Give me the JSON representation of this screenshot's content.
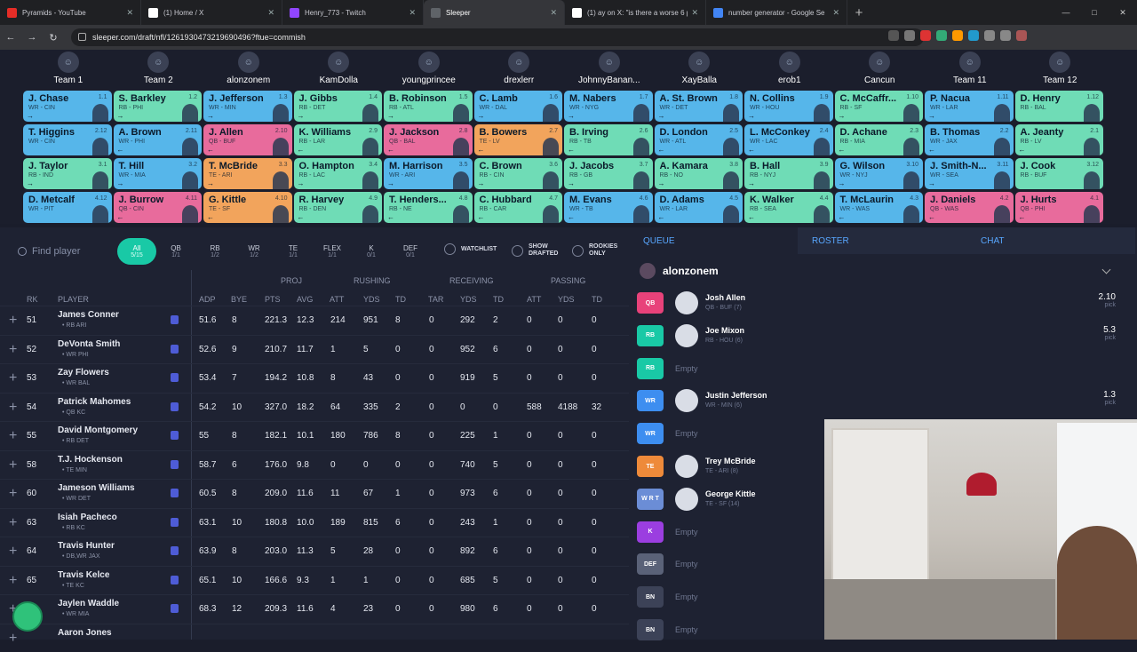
{
  "browser": {
    "tabs": [
      {
        "title": "Pyramids - YouTube",
        "color": "#e52d27"
      },
      {
        "title": "(1) Home / X",
        "color": "#ffffff"
      },
      {
        "title": "Henry_773 - Twitch",
        "color": "#9146ff"
      },
      {
        "title": "Sleeper",
        "color": "#5f6368"
      },
      {
        "title": "(1) ay on X: \"is there a worse 6 p",
        "color": "#ffffff"
      },
      {
        "title": "number generator - Google Se",
        "color": "#4285f4"
      }
    ],
    "url": "sleeper.com/draft/nfl/1261930473219690496?ftue=commish"
  },
  "teams": [
    "Team 1",
    "Team 2",
    "alonzonem",
    "KamDolla",
    "youngprincee",
    "drexlerr",
    "JohnnyBanan...",
    "XayBalla",
    "erob1",
    "Cancun",
    "Team 11",
    "Team 12"
  ],
  "board": [
    [
      {
        "name": "J. Chase",
        "pos": "WR - CIN",
        "pick": "1.1",
        "color": "#56b6ea",
        "arrow": "→"
      },
      {
        "name": "S. Barkley",
        "pos": "RB - PHI",
        "pick": "1.2",
        "color": "#6fdcb6",
        "arrow": "→"
      },
      {
        "name": "J. Jefferson",
        "pos": "WR - MIN",
        "pick": "1.3",
        "color": "#56b6ea",
        "arrow": "→"
      },
      {
        "name": "J. Gibbs",
        "pos": "RB - DET",
        "pick": "1.4",
        "color": "#6fdcb6",
        "arrow": "→"
      },
      {
        "name": "B. Robinson",
        "pos": "RB - ATL",
        "pick": "1.5",
        "color": "#6fdcb6",
        "arrow": "→"
      },
      {
        "name": "C. Lamb",
        "pos": "WR - DAL",
        "pick": "1.6",
        "color": "#56b6ea",
        "arrow": "→"
      },
      {
        "name": "M. Nabers",
        "pos": "WR - NYG",
        "pick": "1.7",
        "color": "#56b6ea",
        "arrow": "→"
      },
      {
        "name": "A. St. Brown",
        "pos": "WR - DET",
        "pick": "1.8",
        "color": "#56b6ea",
        "arrow": "→"
      },
      {
        "name": "N. Collins",
        "pos": "WR - HOU",
        "pick": "1.9",
        "color": "#56b6ea",
        "arrow": "→"
      },
      {
        "name": "C. McCaffr...",
        "pos": "RB - SF",
        "pick": "1.10",
        "color": "#6fdcb6",
        "arrow": "→"
      },
      {
        "name": "P. Nacua",
        "pos": "WR - LAR",
        "pick": "1.11",
        "color": "#56b6ea",
        "arrow": "→"
      },
      {
        "name": "D. Henry",
        "pos": "RB - BAL",
        "pick": "1.12",
        "color": "#6fdcb6",
        "arrow": ""
      }
    ],
    [
      {
        "name": "T. Higgins",
        "pos": "WR - CIN",
        "pick": "2.12",
        "color": "#56b6ea",
        "arrow": ""
      },
      {
        "name": "A. Brown",
        "pos": "WR - PHI",
        "pick": "2.11",
        "color": "#56b6ea",
        "arrow": "←"
      },
      {
        "name": "J. Allen",
        "pos": "QB - BUF",
        "pick": "2.10",
        "color": "#e86b9c",
        "arrow": "←"
      },
      {
        "name": "K. Williams",
        "pos": "RB - LAR",
        "pick": "2.9",
        "color": "#6fdcb6",
        "arrow": "←"
      },
      {
        "name": "J. Jackson",
        "pos": "QB - BAL",
        "pick": "2.8",
        "color": "#e86b9c",
        "arrow": "←"
      },
      {
        "name": "B. Bowers",
        "pos": "TE - LV",
        "pick": "2.7",
        "color": "#f2a45c",
        "arrow": "←"
      },
      {
        "name": "B. Irving",
        "pos": "RB - TB",
        "pick": "2.6",
        "color": "#6fdcb6",
        "arrow": "←"
      },
      {
        "name": "D. London",
        "pos": "WR - ATL",
        "pick": "2.5",
        "color": "#56b6ea",
        "arrow": "←"
      },
      {
        "name": "L. McConkey",
        "pos": "WR - LAC",
        "pick": "2.4",
        "color": "#56b6ea",
        "arrow": "←"
      },
      {
        "name": "D. Achane",
        "pos": "RB - MIA",
        "pick": "2.3",
        "color": "#6fdcb6",
        "arrow": "←"
      },
      {
        "name": "B. Thomas",
        "pos": "WR - JAX",
        "pick": "2.2",
        "color": "#56b6ea",
        "arrow": "←"
      },
      {
        "name": "A. Jeanty",
        "pos": "RB - LV",
        "pick": "2.1",
        "color": "#6fdcb6",
        "arrow": "←"
      }
    ],
    [
      {
        "name": "J. Taylor",
        "pos": "RB - IND",
        "pick": "3.1",
        "color": "#6fdcb6",
        "arrow": "→"
      },
      {
        "name": "T. Hill",
        "pos": "WR - MIA",
        "pick": "3.2",
        "color": "#56b6ea",
        "arrow": "→"
      },
      {
        "name": "T. McBride",
        "pos": "TE - ARI",
        "pick": "3.3",
        "color": "#f2a45c",
        "arrow": "→"
      },
      {
        "name": "O. Hampton",
        "pos": "RB - LAC",
        "pick": "3.4",
        "color": "#6fdcb6",
        "arrow": "→"
      },
      {
        "name": "M. Harrison",
        "pos": "WR - ARI",
        "pick": "3.5",
        "color": "#56b6ea",
        "arrow": "→"
      },
      {
        "name": "C. Brown",
        "pos": "RB - CIN",
        "pick": "3.6",
        "color": "#6fdcb6",
        "arrow": "→"
      },
      {
        "name": "J. Jacobs",
        "pos": "RB - GB",
        "pick": "3.7",
        "color": "#6fdcb6",
        "arrow": "→"
      },
      {
        "name": "A. Kamara",
        "pos": "RB - NO",
        "pick": "3.8",
        "color": "#6fdcb6",
        "arrow": "→"
      },
      {
        "name": "B. Hall",
        "pos": "RB - NYJ",
        "pick": "3.9",
        "color": "#6fdcb6",
        "arrow": "→"
      },
      {
        "name": "G. Wilson",
        "pos": "WR - NYJ",
        "pick": "3.10",
        "color": "#56b6ea",
        "arrow": "→"
      },
      {
        "name": "J. Smith-N...",
        "pos": "WR - SEA",
        "pick": "3.11",
        "color": "#56b6ea",
        "arrow": "→"
      },
      {
        "name": "J. Cook",
        "pos": "RB - BUF",
        "pick": "3.12",
        "color": "#6fdcb6",
        "arrow": ""
      }
    ],
    [
      {
        "name": "D. Metcalf",
        "pos": "WR - PIT",
        "pick": "4.12",
        "color": "#56b6ea",
        "arrow": ""
      },
      {
        "name": "J. Burrow",
        "pos": "QB - CIN",
        "pick": "4.11",
        "color": "#e86b9c",
        "arrow": "←"
      },
      {
        "name": "G. Kittle",
        "pos": "TE - SF",
        "pick": "4.10",
        "color": "#f2a45c",
        "arrow": "←"
      },
      {
        "name": "R. Harvey",
        "pos": "RB - DEN",
        "pick": "4.9",
        "color": "#6fdcb6",
        "arrow": "←"
      },
      {
        "name": "T. Henders...",
        "pos": "RB - NE",
        "pick": "4.8",
        "color": "#6fdcb6",
        "arrow": "←"
      },
      {
        "name": "C. Hubbard",
        "pos": "RB - CAR",
        "pick": "4.7",
        "color": "#6fdcb6",
        "arrow": "←"
      },
      {
        "name": "M. Evans",
        "pos": "WR - TB",
        "pick": "4.6",
        "color": "#56b6ea",
        "arrow": "←"
      },
      {
        "name": "D. Adams",
        "pos": "WR - LAR",
        "pick": "4.5",
        "color": "#56b6ea",
        "arrow": "←"
      },
      {
        "name": "K. Walker",
        "pos": "RB - SEA",
        "pick": "4.4",
        "color": "#6fdcb6",
        "arrow": "←"
      },
      {
        "name": "T. McLaurin",
        "pos": "WR - WAS",
        "pick": "4.3",
        "color": "#56b6ea",
        "arrow": "←"
      },
      {
        "name": "J. Daniels",
        "pos": "QB - WAS",
        "pick": "4.2",
        "color": "#e86b9c",
        "arrow": "←"
      },
      {
        "name": "J. Hurts",
        "pos": "QB - PHI",
        "pick": "4.1",
        "color": "#e86b9c",
        "arrow": "←"
      }
    ]
  ],
  "filters": {
    "search_placeholder": "Find player",
    "positions": [
      {
        "label": "All",
        "count": "5/15"
      },
      {
        "label": "QB",
        "count": "1/1"
      },
      {
        "label": "RB",
        "count": "1/2"
      },
      {
        "label": "WR",
        "count": "1/2"
      },
      {
        "label": "TE",
        "count": "1/1"
      },
      {
        "label": "FLEX",
        "count": "1/1"
      },
      {
        "label": "K",
        "count": "0/1"
      },
      {
        "label": "DEF",
        "count": "0/1"
      }
    ],
    "watchlist": "WATCHLIST",
    "show_drafted": "SHOW DRAFTED",
    "rookies_only": "ROOKIES ONLY"
  },
  "table": {
    "groups": {
      "proj": "PROJ",
      "rushing": "RUSHING",
      "receiving": "RECEIVING",
      "passing": "PASSING"
    },
    "columns": {
      "rk": "RK",
      "player": "PLAYER",
      "adp": "ADP",
      "bye": "BYE",
      "pts": "PTS",
      "avg": "AVG",
      "att": "ATT",
      "yds": "YDS",
      "td": "TD",
      "tar": "TAR",
      "ryds": "YDS",
      "rtd": "TD",
      "patt": "ATT",
      "pyds": "YDS",
      "ptd": "TD"
    },
    "rows": [
      {
        "rk": "51",
        "name": "James Conner",
        "pos": "RB",
        "team": "ARI",
        "adp": "51.6",
        "bye": "8",
        "pts": "221.3",
        "avg": "12.3",
        "att": "214",
        "yds": "951",
        "td": "8",
        "tar": "0",
        "ryds": "292",
        "rtd": "2",
        "patt": "0",
        "pyds": "0",
        "ptd": "0"
      },
      {
        "rk": "52",
        "name": "DeVonta Smith",
        "pos": "WR",
        "team": "PHI",
        "adp": "52.6",
        "bye": "9",
        "pts": "210.7",
        "avg": "11.7",
        "att": "1",
        "yds": "5",
        "td": "0",
        "tar": "0",
        "ryds": "952",
        "rtd": "6",
        "patt": "0",
        "pyds": "0",
        "ptd": "0"
      },
      {
        "rk": "53",
        "name": "Zay Flowers",
        "pos": "WR",
        "team": "BAL",
        "adp": "53.4",
        "bye": "7",
        "pts": "194.2",
        "avg": "10.8",
        "att": "8",
        "yds": "43",
        "td": "0",
        "tar": "0",
        "ryds": "919",
        "rtd": "5",
        "patt": "0",
        "pyds": "0",
        "ptd": "0"
      },
      {
        "rk": "54",
        "name": "Patrick Mahomes",
        "pos": "QB",
        "team": "KC",
        "adp": "54.2",
        "bye": "10",
        "pts": "327.0",
        "avg": "18.2",
        "att": "64",
        "yds": "335",
        "td": "2",
        "tar": "0",
        "ryds": "0",
        "rtd": "0",
        "patt": "588",
        "pyds": "4188",
        "ptd": "32"
      },
      {
        "rk": "55",
        "name": "David Montgomery",
        "pos": "RB",
        "team": "DET",
        "adp": "55",
        "bye": "8",
        "pts": "182.1",
        "avg": "10.1",
        "att": "180",
        "yds": "786",
        "td": "8",
        "tar": "0",
        "ryds": "225",
        "rtd": "1",
        "patt": "0",
        "pyds": "0",
        "ptd": "0"
      },
      {
        "rk": "58",
        "name": "T.J. Hockenson",
        "pos": "TE",
        "team": "MIN",
        "adp": "58.7",
        "bye": "6",
        "pts": "176.0",
        "avg": "9.8",
        "att": "0",
        "yds": "0",
        "td": "0",
        "tar": "0",
        "ryds": "740",
        "rtd": "5",
        "patt": "0",
        "pyds": "0",
        "ptd": "0"
      },
      {
        "rk": "60",
        "name": "Jameson Williams",
        "pos": "WR",
        "team": "DET",
        "adp": "60.5",
        "bye": "8",
        "pts": "209.0",
        "avg": "11.6",
        "att": "11",
        "yds": "67",
        "td": "1",
        "tar": "0",
        "ryds": "973",
        "rtd": "6",
        "patt": "0",
        "pyds": "0",
        "ptd": "0"
      },
      {
        "rk": "63",
        "name": "Isiah Pacheco",
        "pos": "RB",
        "team": "KC",
        "adp": "63.1",
        "bye": "10",
        "pts": "180.8",
        "avg": "10.0",
        "att": "189",
        "yds": "815",
        "td": "6",
        "tar": "0",
        "ryds": "243",
        "rtd": "1",
        "patt": "0",
        "pyds": "0",
        "ptd": "0"
      },
      {
        "rk": "64",
        "name": "Travis Hunter",
        "pos": "DB,WR",
        "team": "JAX",
        "adp": "63.9",
        "bye": "8",
        "pts": "203.0",
        "avg": "11.3",
        "att": "5",
        "yds": "28",
        "td": "0",
        "tar": "0",
        "ryds": "892",
        "rtd": "6",
        "patt": "0",
        "pyds": "0",
        "ptd": "0"
      },
      {
        "rk": "65",
        "name": "Travis Kelce",
        "pos": "TE",
        "team": "KC",
        "adp": "65.1",
        "bye": "10",
        "pts": "166.6",
        "avg": "9.3",
        "att": "1",
        "yds": "1",
        "td": "0",
        "tar": "0",
        "ryds": "685",
        "rtd": "5",
        "patt": "0",
        "pyds": "0",
        "ptd": "0"
      },
      {
        "rk": "",
        "name": "Jaylen Waddle",
        "pos": "WR",
        "team": "MIA",
        "adp": "68.3",
        "bye": "12",
        "pts": "209.3",
        "avg": "11.6",
        "att": "4",
        "yds": "23",
        "td": "0",
        "tar": "0",
        "ryds": "980",
        "rtd": "6",
        "patt": "0",
        "pyds": "0",
        "ptd": "0"
      },
      {
        "rk": "",
        "name": "Aaron Jones",
        "pos": "",
        "team": "",
        "adp": "",
        "bye": "",
        "pts": "",
        "avg": "",
        "att": "",
        "yds": "",
        "td": "",
        "tar": "",
        "ryds": "",
        "rtd": "",
        "patt": "",
        "pyds": "",
        "ptd": ""
      }
    ]
  },
  "panel": {
    "tabs": [
      "QUEUE",
      "ROSTER",
      "CHAT"
    ],
    "owner": "alonzonem",
    "slots": [
      {
        "badge": "QB",
        "color": "#e8427a",
        "name": "Josh Allen",
        "sub": "QB - BUF (7)",
        "pick": "2.10",
        "pick_label": "pick"
      },
      {
        "badge": "RB",
        "color": "#19c9a6",
        "name": "Joe Mixon",
        "sub": "RB - HOU (6)",
        "pick": "5.3",
        "pick_label": "pick"
      },
      {
        "badge": "RB",
        "color": "#19c9a6",
        "name": "",
        "sub": "",
        "empty": "Empty",
        "pick": "",
        "pick_label": ""
      },
      {
        "badge": "WR",
        "color": "#3d8ef0",
        "name": "Justin Jefferson",
        "sub": "WR - MIN (6)",
        "pick": "1.3",
        "pick_label": "pick"
      },
      {
        "badge": "WR",
        "color": "#3d8ef0",
        "name": "",
        "sub": "",
        "empty": "Empty",
        "pick": "",
        "pick_label": ""
      },
      {
        "badge": "TE",
        "color": "#ee8a3a",
        "name": "Trey McBride",
        "sub": "TE - ARI (8)",
        "pick": "",
        "pick_label": ""
      },
      {
        "badge": "W R T",
        "color": "#6b8dd6",
        "name": "George Kittle",
        "sub": "TE - SF (14)",
        "pick": "",
        "pick_label": ""
      },
      {
        "badge": "K",
        "color": "#9b3ee0",
        "name": "",
        "sub": "",
        "empty": "Empty",
        "pick": "",
        "pick_label": ""
      },
      {
        "badge": "DEF",
        "color": "#5a6278",
        "name": "",
        "sub": "",
        "empty": "Empty",
        "pick": "",
        "pick_label": ""
      },
      {
        "badge": "BN",
        "color": "#3c4257",
        "name": "",
        "sub": "",
        "empty": "Empty",
        "pick": "",
        "pick_label": ""
      },
      {
        "badge": "BN",
        "color": "#3c4257",
        "name": "",
        "sub": "",
        "empty": "Empty",
        "pick": "",
        "pick_label": ""
      }
    ]
  }
}
